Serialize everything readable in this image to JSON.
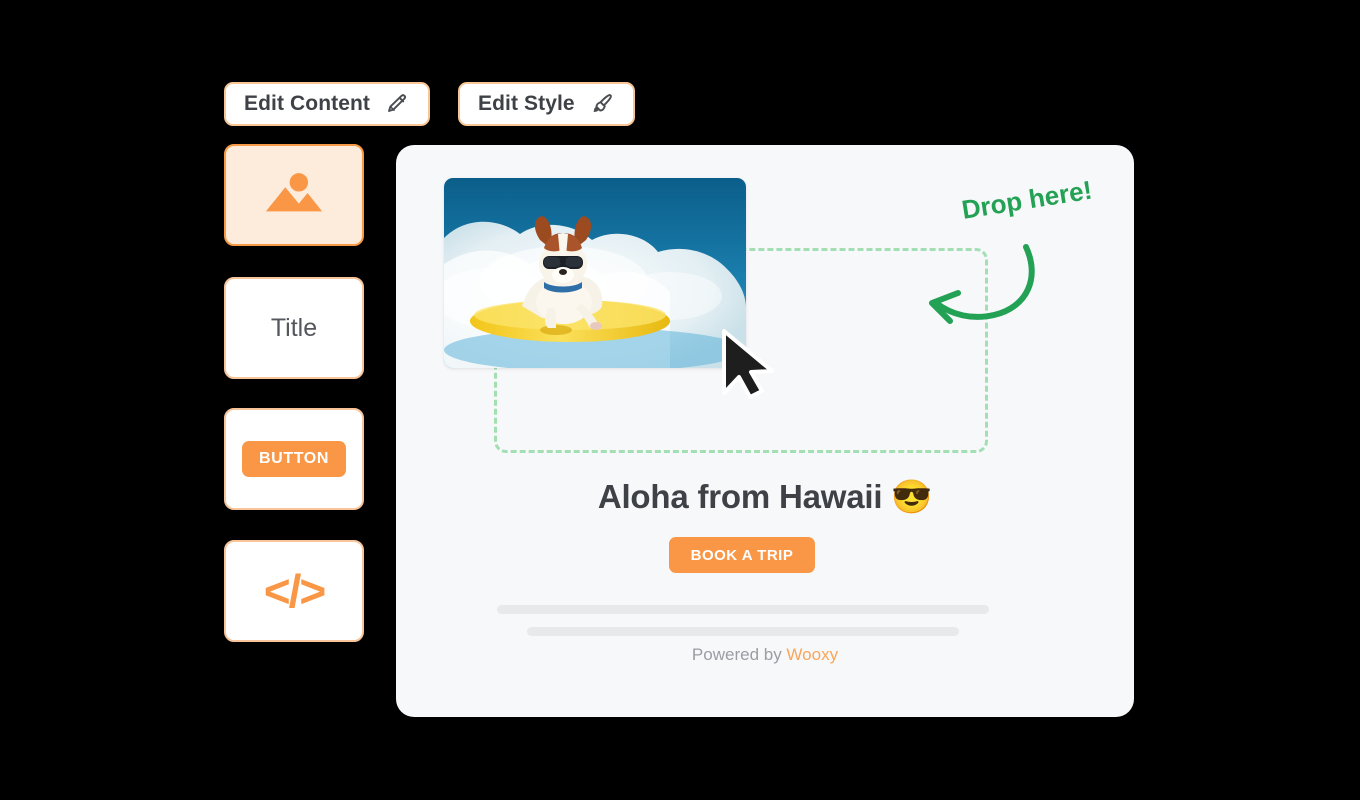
{
  "toolbar": {
    "edit_content": {
      "label": "Edit Content",
      "icon": "pencil-icon"
    },
    "edit_style": {
      "label": "Edit Style",
      "icon": "paintbrush-icon"
    }
  },
  "palette": {
    "items": [
      {
        "name": "image-block",
        "label": "",
        "icon": "image-icon",
        "selected": true
      },
      {
        "name": "title-block",
        "label": "Title",
        "icon": "",
        "selected": false
      },
      {
        "name": "button-block",
        "label": "BUTTON",
        "icon": "",
        "selected": false
      },
      {
        "name": "html-block",
        "label": "</>",
        "icon": "code-icon",
        "selected": false
      }
    ]
  },
  "preview": {
    "dropzone": {
      "hint": "Drop here!"
    },
    "image": {
      "alt": "dog-surfing-on-yellow-surfboard"
    },
    "headline": "Aloha from Hawaii 😎",
    "cta_label": "BOOK A TRIP",
    "footer": {
      "prefix": "Powered by ",
      "brand": "Wooxy"
    }
  },
  "colors": {
    "accent_orange": "#F99746",
    "accent_orange_border": "#F8C49A",
    "palette_selected_bg": "#FDEBDC",
    "drop_green": "#23A154",
    "dropzone_dash_green": "#A4DFB4",
    "card_bg": "#F7F8FA",
    "page_bg": "#000000",
    "text_dark": "#3E4146",
    "text_muted": "#9A9DA3",
    "skeleton_gray": "#E8E9EB"
  }
}
